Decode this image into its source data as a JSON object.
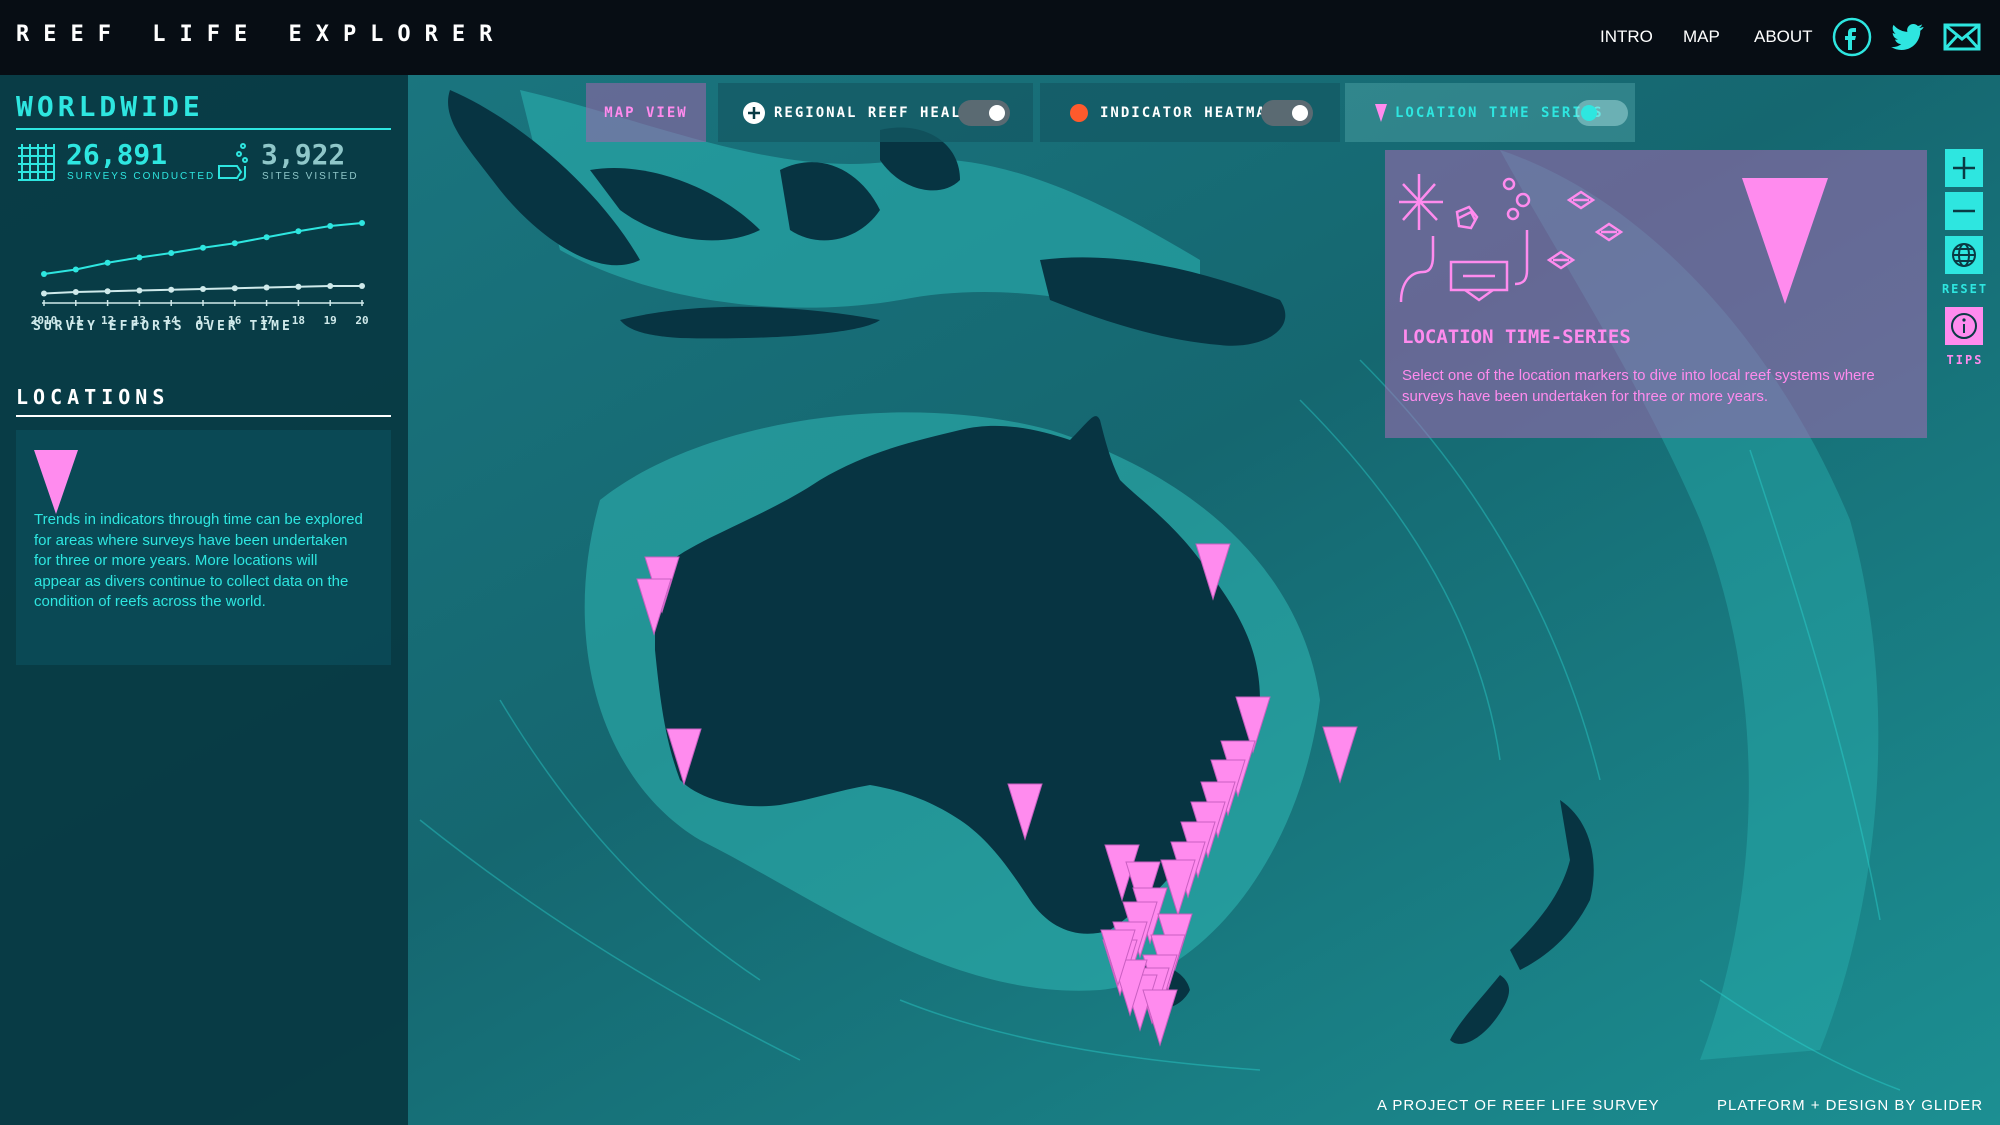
{
  "brand": {
    "title": "REEF LIFE EXPLORER"
  },
  "nav": {
    "intro": "INTRO",
    "map": "MAP",
    "about": "ABOUT"
  },
  "social": [
    "facebook-icon",
    "twitter-icon",
    "mail-icon"
  ],
  "sidebar": {
    "worldwide_title": "WORLDWIDE",
    "surveys_value": "26,891",
    "surveys_label": "SURVEYS CONDUCTED",
    "sites_value": "3,922",
    "sites_label": "SITES VISITED",
    "chart_caption": "SURVEY EFFORTS OVER TIME",
    "locations_title": "LOCATIONS",
    "locations_desc": "Trends in indicators through time can be explored for areas where surveys have been undertaken for three or more years. More locations will appear as divers continue to collect data on the condition of reefs across the world."
  },
  "chart_data": {
    "type": "line",
    "x": [
      "2010",
      "11",
      "12",
      "13",
      "14",
      "15",
      "16",
      "17",
      "18",
      "19",
      "20"
    ],
    "series": [
      {
        "values": [
          0.28,
          0.34,
          0.43,
          0.5,
          0.56,
          0.63,
          0.69,
          0.77,
          0.85,
          0.92,
          0.96
        ]
      },
      {
        "values": [
          0.02,
          0.04,
          0.05,
          0.06,
          0.07,
          0.08,
          0.09,
          0.1,
          0.11,
          0.12,
          0.12
        ]
      }
    ],
    "xlabel": "",
    "ylabel": "",
    "grid": false
  },
  "toolbar": {
    "map_view": "MAP VIEW",
    "regional": "REGIONAL REEF HEALTH",
    "heatmap": "INDICATOR HEATMAP",
    "timeseries": "LOCATION TIME SERIES"
  },
  "info": {
    "title": "LOCATION TIME-SERIES",
    "desc": "Select one of the location markers to dive into local reef systems where surveys have been undertaken for three or more years."
  },
  "controls": {
    "reset": "RESET",
    "tips": "TIPS"
  },
  "footer": {
    "left": "A PROJECT OF REEF LIFE SURVEY",
    "right": "PLATFORM + DESIGN BY GLIDER"
  },
  "colors": {
    "accent": "#2ee6e0",
    "pink": "#ff8bee",
    "ocean": "#0a3a44",
    "land": "#073442",
    "shelf": "#2aa3a6"
  }
}
